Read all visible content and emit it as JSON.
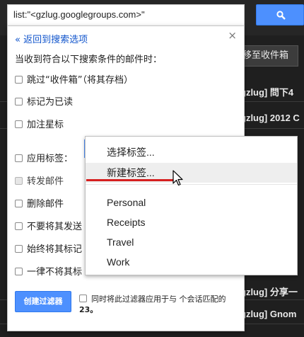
{
  "search": {
    "query": "list:\"<gzlug.googlegroups.com>\""
  },
  "background": {
    "move_button": "移至收件箱",
    "subjects": [
      "gzlug] 問下4",
      "gzlug] 2012 C",
      "gzlug] 分享一",
      "gzlug] Gnom"
    ]
  },
  "filter_panel": {
    "back_link": "« 返回到搜索选项",
    "close": "×",
    "title": "当收到符合以下搜索条件的邮件时：",
    "options": [
      {
        "label": "跳过“收件箱”（将其存档）",
        "checked": false,
        "disabled": false
      },
      {
        "label": "标记为已读",
        "checked": false,
        "disabled": false
      },
      {
        "label": "加注星标",
        "checked": false,
        "disabled": false
      },
      {
        "label": "应用标签：",
        "checked": false,
        "disabled": false
      },
      {
        "label": "转发邮件",
        "checked": false,
        "disabled": true
      },
      {
        "label": "删除邮件",
        "checked": false,
        "disabled": false
      },
      {
        "label": "不要将其发送",
        "checked": false,
        "disabled": false
      },
      {
        "label": "始终将其标记",
        "checked": false,
        "disabled": false
      },
      {
        "label": "一律不将其标",
        "checked": false,
        "disabled": false
      }
    ],
    "create_button": "创建过滤器",
    "apply_text": "同时将此过滤器应用于与 个会话匹配的",
    "apply_count": "23。"
  },
  "label_menu": {
    "choose": "选择标签...",
    "new_label": "新建标签...",
    "labels": [
      "Personal",
      "Receipts",
      "Travel",
      "Work"
    ]
  },
  "colors": {
    "accent": "#4d90fe",
    "link": "#1155cc",
    "highlight_line": "#d62020"
  }
}
